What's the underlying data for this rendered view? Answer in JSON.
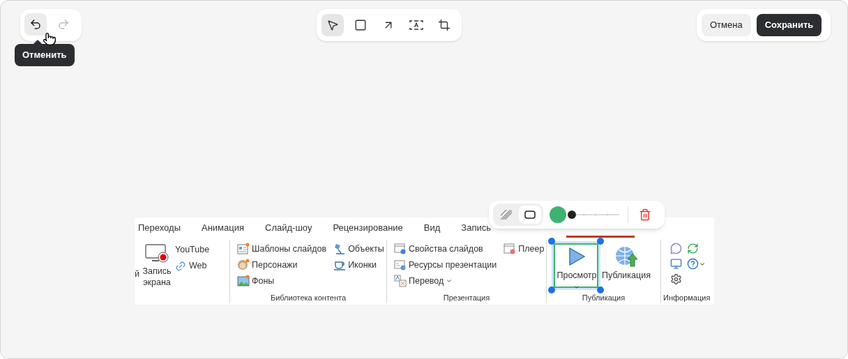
{
  "history": {
    "undo": {
      "disabled": false
    },
    "redo": {
      "disabled": true
    },
    "tooltip": "Отменить"
  },
  "tools": [
    {
      "kind": "select",
      "selected": true
    },
    {
      "kind": "rectangle",
      "selected": false
    },
    {
      "kind": "arrow",
      "selected": false
    },
    {
      "kind": "text",
      "selected": false
    },
    {
      "kind": "crop",
      "selected": false
    }
  ],
  "actions": {
    "cancel": "Отмена",
    "save": "Сохранить"
  },
  "screenshot": {
    "tabs": [
      {
        "label": "Переходы"
      },
      {
        "label": "Анимация"
      },
      {
        "label": "Слайд-шоу"
      },
      {
        "label": "Рецензирование"
      },
      {
        "label": "Вид"
      },
      {
        "label": "Запись"
      }
    ],
    "record_group": {
      "cut_text": "й",
      "big_button": "Запись экрана",
      "items": [
        {
          "kind": "video",
          "label": "YouTube"
        },
        {
          "kind": "link",
          "label": "Web"
        }
      ]
    },
    "groups": [
      {
        "label": "Библиотека контента",
        "columns": [
          [
            {
              "kind": "template",
              "label": "Шаблоны слайдов"
            },
            {
              "kind": "character",
              "label": "Персонажи"
            },
            {
              "kind": "background",
              "label": "Фоны"
            }
          ],
          [
            {
              "kind": "lamp",
              "label": "Объекты"
            },
            {
              "kind": "cup",
              "label": "Иконки"
            }
          ]
        ]
      },
      {
        "label": "Презентация",
        "columns": [
          [
            {
              "kind": "properties",
              "label": "Свойства слайдов",
              "dropdown": false
            },
            {
              "kind": "resources",
              "label": "Ресурсы презентации",
              "dropdown": false
            },
            {
              "kind": "translate",
              "label": "Перевод",
              "dropdown": true
            }
          ],
          [
            {
              "kind": "player",
              "label": "Плеер",
              "dropdown": false
            }
          ]
        ]
      }
    ],
    "publish_group": {
      "label": "Публикация",
      "buttons": [
        {
          "kind": "play",
          "label": "Просмотр",
          "dropdown": true,
          "selected": true
        },
        {
          "kind": "globe",
          "label": "Публикация",
          "dropdown": false,
          "selected": false
        }
      ]
    },
    "info_group": {
      "label": "Информация"
    }
  },
  "shape_toolbar": {
    "fill_modes": [
      {
        "kind": "hatch",
        "selected": false
      },
      {
        "kind": "outline",
        "selected": true
      }
    ],
    "color": "#3cb371",
    "stroke": {
      "level": 0
    }
  }
}
